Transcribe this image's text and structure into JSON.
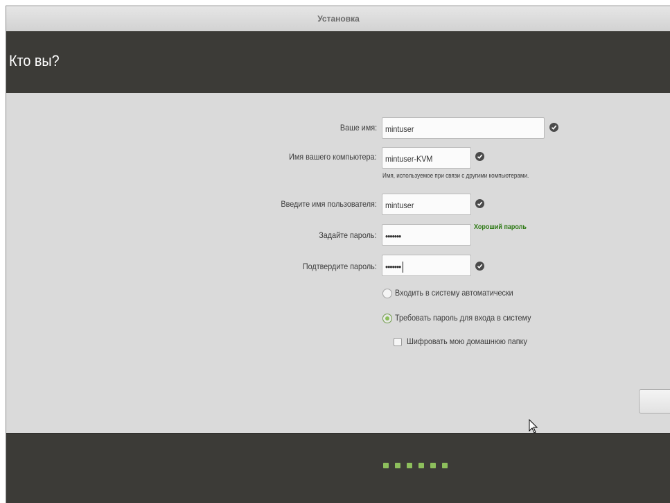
{
  "window": {
    "title": "Установка"
  },
  "header": {
    "title": "Кто вы?"
  },
  "form": {
    "name": {
      "label": "Ваше имя:",
      "value": "mintuser"
    },
    "computer": {
      "label": "Имя вашего компьютера:",
      "value": "mintuser-KVM",
      "hint": "Имя, используемое при связи с другими компьютерами."
    },
    "username": {
      "label": "Введите имя пользователя:",
      "value": "mintuser"
    },
    "password": {
      "label": "Задайте пароль:",
      "value": "•••••••",
      "strength": "Хороший пароль"
    },
    "confirm": {
      "label": "Подтвердите пароль:",
      "value": "•••••••"
    }
  },
  "options": {
    "autologin": {
      "label": "Входить в систему автоматически",
      "selected": false
    },
    "require_password": {
      "label": "Требовать пароль для входа в систему",
      "selected": true
    },
    "encrypt_home": {
      "label": "Шифровать мою домашнюю папку",
      "checked": false
    }
  },
  "progress": {
    "total_steps": 6
  },
  "colors": {
    "accent": "#8dbf5c",
    "header_bg": "#3c3b37",
    "strength_good": "#2e7a15"
  }
}
